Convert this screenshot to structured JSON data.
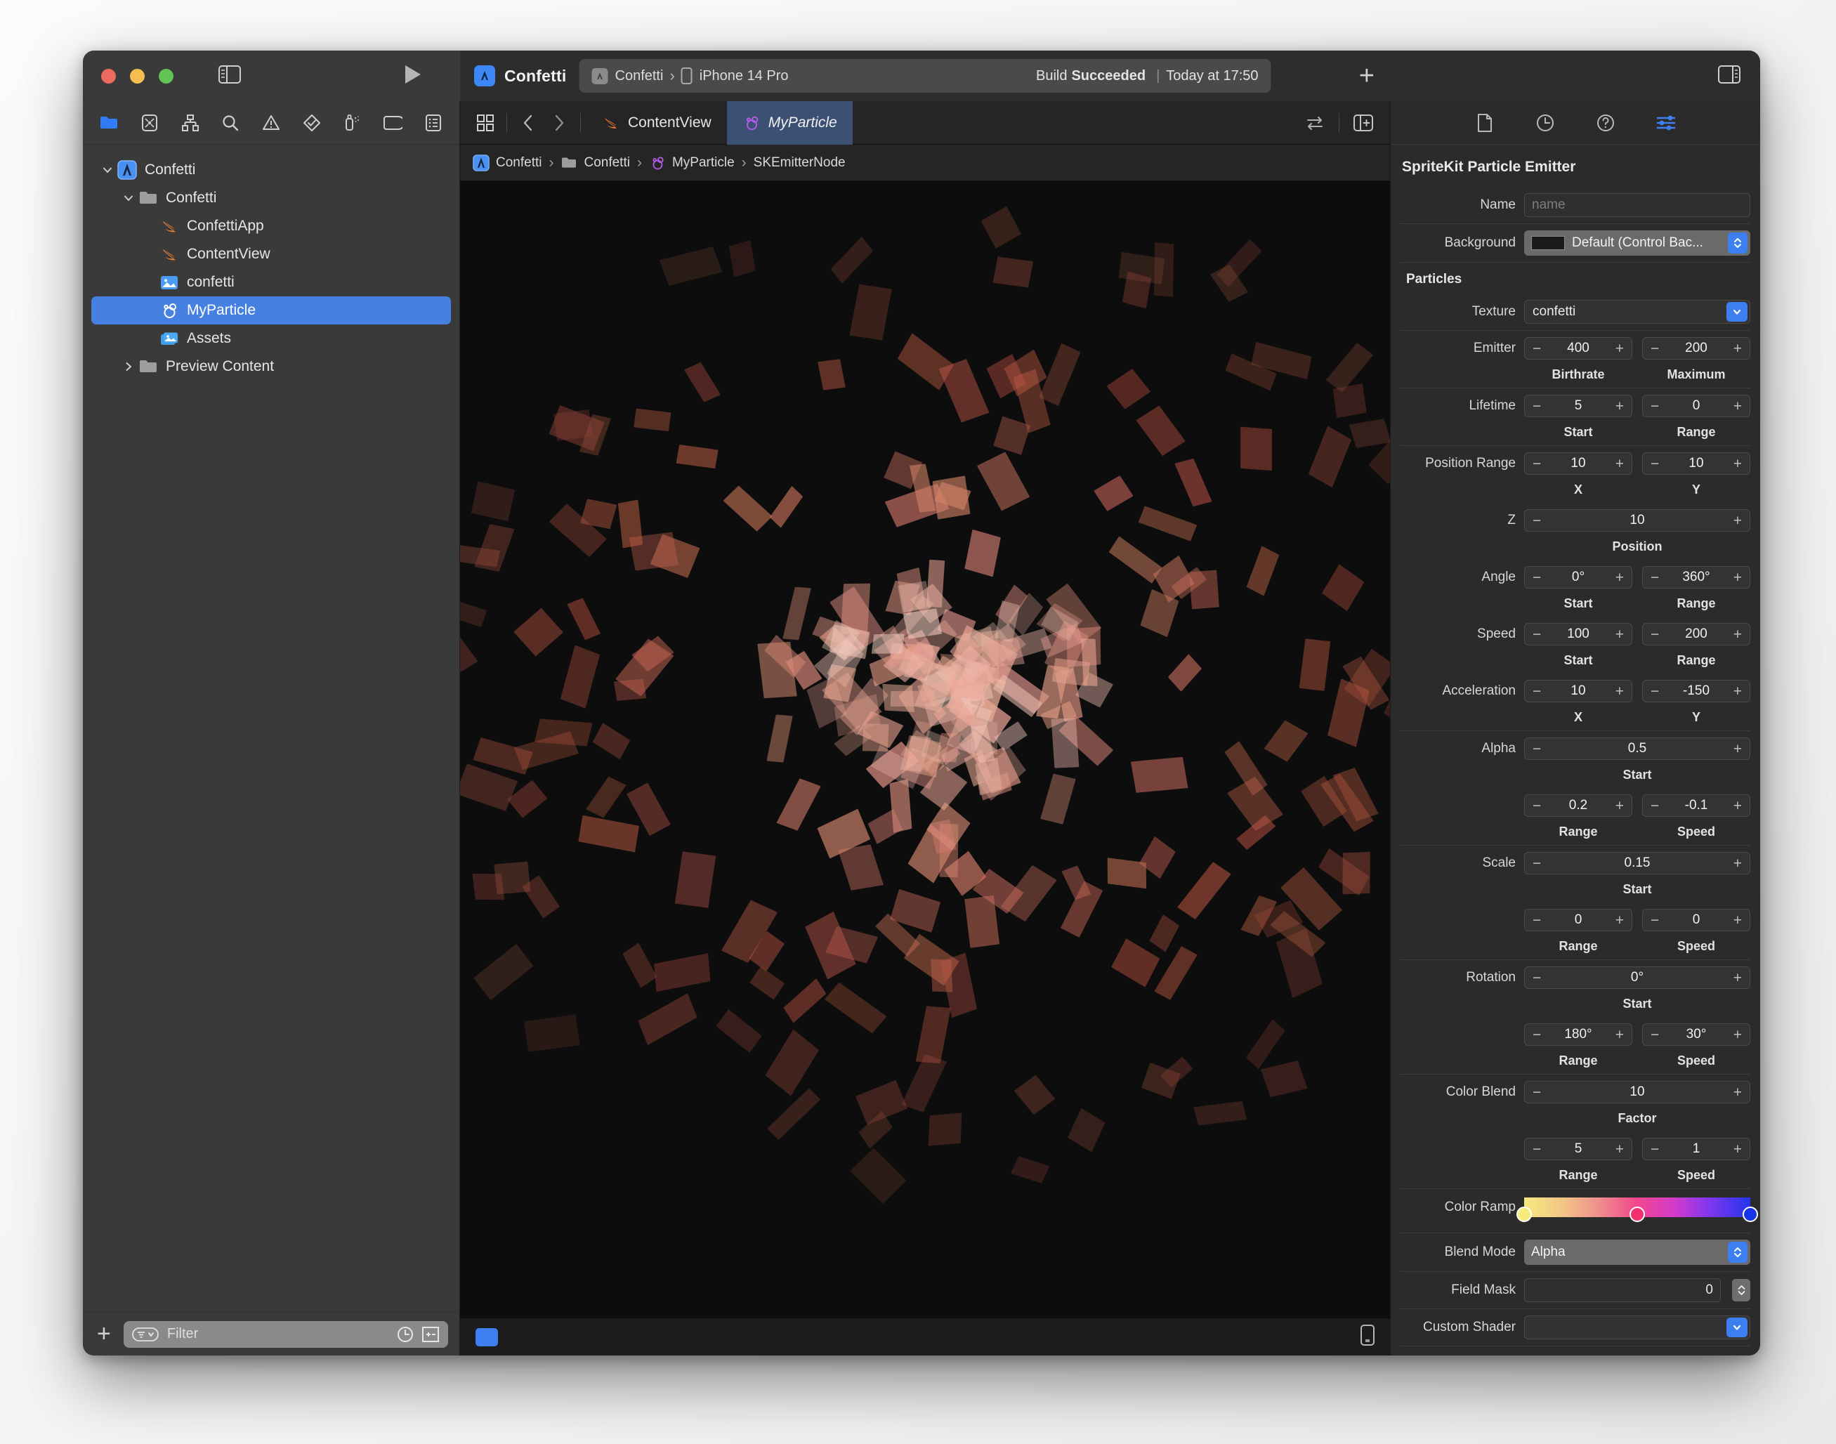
{
  "window": {
    "traffic_lights": [
      "close",
      "minimize",
      "zoom"
    ],
    "scheme_title": "Confetti",
    "status": {
      "project": "Confetti",
      "device": "iPhone 14 Pro",
      "build_prefix": "Build",
      "build_result": "Succeeded",
      "build_time": "Today at 17:50"
    }
  },
  "navigator": {
    "toolbar_icons": [
      "folder-icon",
      "source-control-icon",
      "hierarchy-icon",
      "search-icon",
      "warning-icon",
      "test-icon",
      "debug-icon",
      "breakpoint-icon",
      "report-icon"
    ],
    "tree": [
      {
        "label": "Confetti",
        "icon": "xcode-project-icon",
        "depth": 0,
        "twisty": "down",
        "selected": false
      },
      {
        "label": "Confetti",
        "icon": "folder-icon",
        "depth": 1,
        "twisty": "down",
        "selected": false
      },
      {
        "label": "ConfettiApp",
        "icon": "swift-icon",
        "depth": 2,
        "twisty": "",
        "selected": false
      },
      {
        "label": "ContentView",
        "icon": "swift-icon",
        "depth": 2,
        "twisty": "",
        "selected": false
      },
      {
        "label": "confetti",
        "icon": "image-icon",
        "depth": 2,
        "twisty": "",
        "selected": false
      },
      {
        "label": "MyParticle",
        "icon": "particle-icon",
        "depth": 2,
        "twisty": "",
        "selected": true
      },
      {
        "label": "Assets",
        "icon": "assets-icon",
        "depth": 2,
        "twisty": "",
        "selected": false
      },
      {
        "label": "Preview Content",
        "icon": "folder-icon",
        "depth": 1,
        "twisty": "right",
        "selected": false
      }
    ],
    "filter": {
      "placeholder": "Filter",
      "value": ""
    }
  },
  "editor": {
    "tabs": [
      {
        "label": "ContentView",
        "icon": "swift-icon",
        "active": false
      },
      {
        "label": "MyParticle",
        "icon": "particle-icon",
        "active": true
      }
    ],
    "breadcrumb": [
      {
        "label": "Confetti",
        "icon": "xcode-project-icon"
      },
      {
        "label": "Confetti",
        "icon": "folder-icon"
      },
      {
        "label": "MyParticle",
        "icon": "particle-icon"
      },
      {
        "label": "SKEmitterNode",
        "icon": ""
      }
    ],
    "canvas_background": "#0d0d0d"
  },
  "inspector": {
    "tabs": [
      "file-inspector-icon",
      "history-inspector-icon",
      "quick-help-icon",
      "attributes-inspector-icon"
    ],
    "active_tab": "attributes-inspector-icon",
    "title": "SpriteKit Particle Emitter",
    "name": {
      "label": "Name",
      "placeholder": "name",
      "value": ""
    },
    "background": {
      "label": "Background",
      "value": "Default (Control Bac...",
      "swatch": "#1b1b1b"
    },
    "particles_section": "Particles",
    "texture": {
      "label": "Texture",
      "value": "confetti"
    },
    "emitter": {
      "label": "Emitter",
      "birthrate": "400",
      "maximum": "200",
      "cap1": "Birthrate",
      "cap2": "Maximum"
    },
    "lifetime": {
      "label": "Lifetime",
      "start": "5",
      "range": "0",
      "cap1": "Start",
      "cap2": "Range"
    },
    "position_range": {
      "label": "Position Range",
      "x": "10",
      "y": "10",
      "cap1": "X",
      "cap2": "Y"
    },
    "z": {
      "label": "Z",
      "value": "10",
      "cap": "Position"
    },
    "angle": {
      "label": "Angle",
      "start": "0°",
      "range": "360°",
      "cap1": "Start",
      "cap2": "Range"
    },
    "speed": {
      "label": "Speed",
      "start": "100",
      "range": "200",
      "cap1": "Start",
      "cap2": "Range"
    },
    "acceleration": {
      "label": "Acceleration",
      "x": "10",
      "y": "-150",
      "cap1": "X",
      "cap2": "Y"
    },
    "alpha": {
      "label": "Alpha",
      "start": "0.5",
      "cap_start": "Start",
      "range": "0.2",
      "speed": "-0.1",
      "cap1": "Range",
      "cap2": "Speed"
    },
    "scale": {
      "label": "Scale",
      "start": "0.15",
      "cap_start": "Start",
      "range": "0",
      "speed": "0",
      "cap1": "Range",
      "cap2": "Speed"
    },
    "rotation": {
      "label": "Rotation",
      "start": "0°",
      "cap_start": "Start",
      "range": "180°",
      "speed": "30°",
      "cap1": "Range",
      "cap2": "Speed"
    },
    "color_blend": {
      "label": "Color Blend",
      "factor": "10",
      "cap_factor": "Factor",
      "range": "5",
      "speed": "1",
      "cap1": "Range",
      "cap2": "Speed"
    },
    "color_ramp": {
      "label": "Color Ramp",
      "stops": [
        {
          "position": 0,
          "color": "#f5ec7a"
        },
        {
          "position": 50,
          "color": "#f0316e"
        },
        {
          "position": 100,
          "color": "#1733e8"
        }
      ],
      "gradient": "linear-gradient(90deg,#f7e97e 0%,#f2c388 18%,#ef8f8d 33%,#f2468c 50%,#d43bc9 66%,#8a37ee 80%,#2236ef 100%)"
    },
    "blend_mode": {
      "label": "Blend Mode",
      "value": "Alpha"
    },
    "field_mask": {
      "label": "Field Mask",
      "value": "0"
    },
    "custom_shader": {
      "label": "Custom Shader",
      "value": ""
    }
  },
  "colors": {
    "accent_blue": "#3d7ff0",
    "selection_blue": "#4680e0",
    "swift_orange": "#f08033",
    "particle_purple": "#b85cf0",
    "window_bg": "#2b2b2b",
    "navigator_bg": "#3a3a3a",
    "canvas_bg": "#0d0d0d"
  }
}
